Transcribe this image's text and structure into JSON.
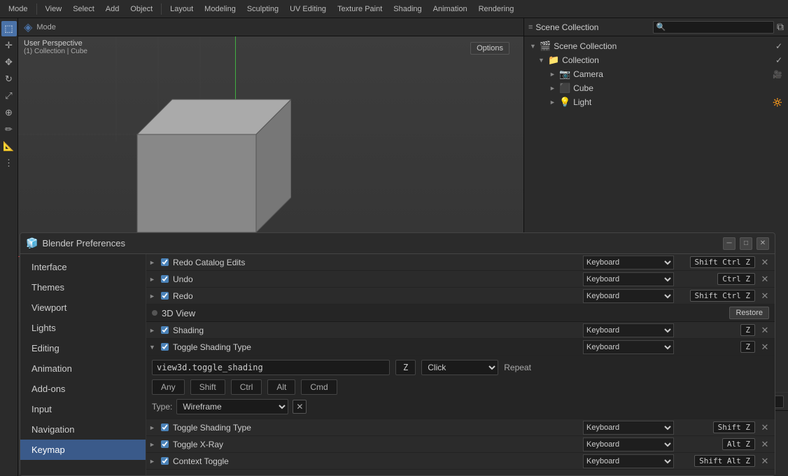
{
  "app": {
    "title": "Blender Preferences",
    "icon": "🧊"
  },
  "topToolbar": {
    "menus": [
      "Mode",
      "View",
      "Select",
      "Add",
      "Object",
      "Layout",
      "Modeling",
      "Sculpting",
      "UV Editing",
      "Texture Paint",
      "Shading",
      "Animation",
      "Rendering"
    ]
  },
  "viewport": {
    "label": "User Perspective",
    "sublabel": "(1) Collection | Cube",
    "options_btn": "Options"
  },
  "outliner": {
    "title": "Scene Collection",
    "items": [
      {
        "indent": 1,
        "arrow": "▼",
        "icon": "📁",
        "label": "Collection",
        "check": true
      },
      {
        "indent": 2,
        "arrow": "►",
        "icon": "📷",
        "label": "Camera",
        "check": false
      },
      {
        "indent": 2,
        "arrow": "►",
        "icon": "⬛",
        "label": "Cube",
        "check": false
      },
      {
        "indent": 2,
        "arrow": "►",
        "icon": "💡",
        "label": "Light",
        "check": false
      }
    ]
  },
  "prefs": {
    "title": "Blender Preferences",
    "nav_items": [
      {
        "id": "interface",
        "label": "Interface",
        "active": false
      },
      {
        "id": "themes",
        "label": "Themes",
        "active": false
      },
      {
        "id": "viewport",
        "label": "Viewport",
        "active": false
      },
      {
        "id": "lights",
        "label": "Lights",
        "active": false
      },
      {
        "id": "editing",
        "label": "Editing",
        "active": false
      },
      {
        "id": "animation",
        "label": "Animation",
        "active": false
      },
      {
        "id": "addons",
        "label": "Add-ons",
        "active": false
      },
      {
        "id": "input",
        "label": "Input",
        "active": false
      },
      {
        "id": "navigation",
        "label": "Navigation",
        "active": false
      },
      {
        "id": "keymap",
        "label": "Keymap",
        "active": true
      }
    ],
    "keymap": {
      "rows": [
        {
          "type": "row",
          "arrow": "►",
          "checked": true,
          "name": "Redo Catalog Edits",
          "input": "Keyboard",
          "shortcut": "Shift Ctrl Z",
          "hasX": true
        },
        {
          "type": "row",
          "arrow": "►",
          "checked": true,
          "name": "Undo",
          "input": "Keyboard",
          "shortcut": "Ctrl Z",
          "hasX": true
        },
        {
          "type": "row",
          "arrow": "►",
          "checked": true,
          "name": "Redo",
          "input": "Keyboard",
          "shortcut": "Shift Ctrl Z",
          "hasX": true
        }
      ],
      "section": {
        "name": "3D View",
        "restore_label": "Restore"
      },
      "sub_rows": [
        {
          "type": "row",
          "arrow": "►",
          "checked": true,
          "name": "Shading",
          "input": "Keyboard",
          "shortcut": "Z",
          "hasX": true
        },
        {
          "type": "row",
          "arrow": "▼",
          "checked": true,
          "name": "Toggle Shading Type",
          "input": "Keyboard",
          "shortcut": "Z",
          "hasX": true,
          "expanded": true
        }
      ],
      "detail": {
        "opname": "view3d.toggle_shading",
        "key": "Z",
        "event": "Click",
        "repeat": "Repeat",
        "modifiers": [
          "Any",
          "Shift",
          "Ctrl",
          "Alt",
          "Cmd"
        ],
        "type_label": "Type:",
        "type_value": "Wireframe"
      },
      "more_rows": [
        {
          "type": "row",
          "arrow": "►",
          "checked": true,
          "name": "Toggle Shading Type",
          "input": "Keyboard",
          "shortcut": "Shift Z",
          "hasX": true
        },
        {
          "type": "row",
          "arrow": "►",
          "checked": true,
          "name": "Toggle X-Ray",
          "input": "Keyboard",
          "shortcut": "Alt Z",
          "hasX": true
        },
        {
          "type": "row",
          "arrow": "►",
          "checked": true,
          "name": "Context Toggle",
          "input": "Keyboard",
          "shortcut": "Shift Alt Z",
          "hasX": true
        }
      ]
    }
  }
}
